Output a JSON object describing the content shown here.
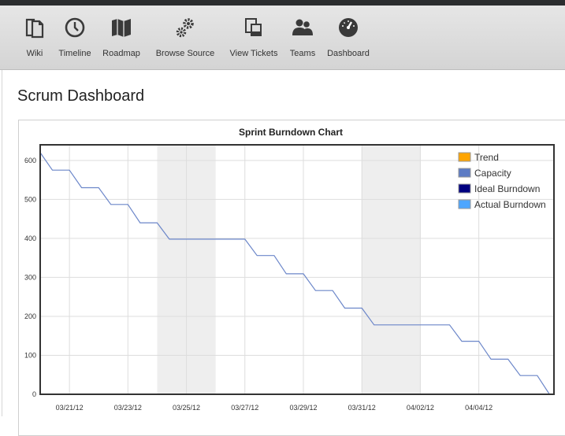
{
  "nav": {
    "items": [
      {
        "label": "Wiki",
        "icon": "wiki-icon"
      },
      {
        "label": "Timeline",
        "icon": "clock-icon"
      },
      {
        "label": "Roadmap",
        "icon": "map-icon"
      },
      {
        "label": "Browse Source",
        "icon": "gears-icon"
      },
      {
        "label": "View Tickets",
        "icon": "tickets-icon"
      },
      {
        "label": "Teams",
        "icon": "users-icon"
      },
      {
        "label": "Dashboard",
        "icon": "gauge-icon"
      }
    ]
  },
  "page": {
    "title": "Scrum Dashboard"
  },
  "colors": {
    "trend": "#ffa500",
    "capacity": "#5c7bc4",
    "ideal": "#000080",
    "actual": "#4da6ff",
    "weekend_band": "#eeeeee",
    "line": "#6b86c9"
  },
  "chart_data": {
    "type": "line",
    "title": "Sprint Burndown Chart",
    "ylim": [
      0,
      640
    ],
    "yticks": [
      0,
      100,
      200,
      300,
      400,
      500,
      600
    ],
    "x_start": "03/20/12",
    "x_end": "04/06/12",
    "xticks": [
      "03/21/12",
      "03/23/12",
      "03/25/12",
      "03/27/12",
      "03/29/12",
      "03/31/12",
      "04/02/12",
      "04/04/12"
    ],
    "grid": true,
    "legend_position": "top-right",
    "legend": [
      "Trend",
      "Capacity",
      "Ideal Burndown",
      "Actual Burndown"
    ],
    "weekends": [
      [
        "03/24/12",
        "03/26/12"
      ],
      [
        "03/31/12",
        "04/02/12"
      ]
    ],
    "series": [
      {
        "name": "Actual Burndown",
        "points": [
          [
            "03/20/12 00:00",
            620
          ],
          [
            "03/20/12 10:00",
            575
          ],
          [
            "03/21/12 00:00",
            575
          ],
          [
            "03/21/12 10:00",
            530
          ],
          [
            "03/22/12 00:00",
            530
          ],
          [
            "03/22/12 10:00",
            487
          ],
          [
            "03/23/12 00:00",
            487
          ],
          [
            "03/23/12 10:00",
            440
          ],
          [
            "03/24/12 00:00",
            440
          ],
          [
            "03/24/12 10:00",
            398
          ],
          [
            "03/27/12 00:00",
            398
          ],
          [
            "03/27/12 10:00",
            356
          ],
          [
            "03/28/12 00:00",
            356
          ],
          [
            "03/28/12 10:00",
            309
          ],
          [
            "03/29/12 00:00",
            309
          ],
          [
            "03/29/12 10:00",
            266
          ],
          [
            "03/30/12 00:00",
            266
          ],
          [
            "03/30/12 10:00",
            221
          ],
          [
            "03/31/12 00:00",
            221
          ],
          [
            "03/31/12 10:00",
            178
          ],
          [
            "04/03/12 00:00",
            178
          ],
          [
            "04/03/12 10:00",
            136
          ],
          [
            "04/04/12 00:00",
            136
          ],
          [
            "04/04/12 10:00",
            90
          ],
          [
            "04/05/12 00:00",
            90
          ],
          [
            "04/05/12 10:00",
            48
          ],
          [
            "04/06/12 00:00",
            48
          ],
          [
            "04/06/12 10:00",
            0
          ]
        ]
      }
    ]
  }
}
